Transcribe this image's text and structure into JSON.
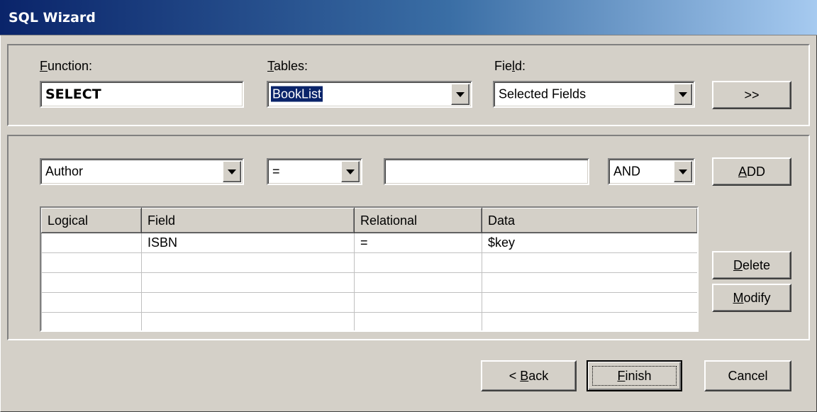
{
  "window": {
    "title": "SQL Wizard"
  },
  "function": {
    "label_key": "F",
    "label_rest": "unction:",
    "value": "SELECT"
  },
  "tables": {
    "label_key": "T",
    "label_rest": "ables:",
    "value": "BookList"
  },
  "field": {
    "label_pre": "Fie",
    "label_key": "l",
    "label_rest": "d:",
    "value": "Selected Fields"
  },
  "add_field_button": {
    "label": ">>"
  },
  "criteria": {
    "field_value": "Author",
    "operator_value": "=",
    "data_value": "",
    "logical_value": "AND",
    "add_button": {
      "label_key": "A",
      "label_rest": "DD"
    }
  },
  "grid": {
    "columns": [
      "Logical",
      "Field",
      "Relational",
      "Data"
    ],
    "rows": [
      [
        "",
        "ISBN",
        "=",
        "$key"
      ],
      [
        "",
        "",
        "",
        ""
      ],
      [
        "",
        "",
        "",
        ""
      ],
      [
        "",
        "",
        "",
        ""
      ],
      [
        "",
        "",
        "",
        ""
      ]
    ]
  },
  "side_buttons": {
    "delete": {
      "label_key": "D",
      "label_rest": "elete"
    },
    "modify": {
      "label_key": "M",
      "label_rest": "odify"
    }
  },
  "footer": {
    "back": {
      "label_pre": "< ",
      "label_key": "B",
      "label_rest": "ack"
    },
    "finish": {
      "label_key": "F",
      "label_rest": "inish"
    },
    "cancel": {
      "label": "Cancel"
    }
  }
}
